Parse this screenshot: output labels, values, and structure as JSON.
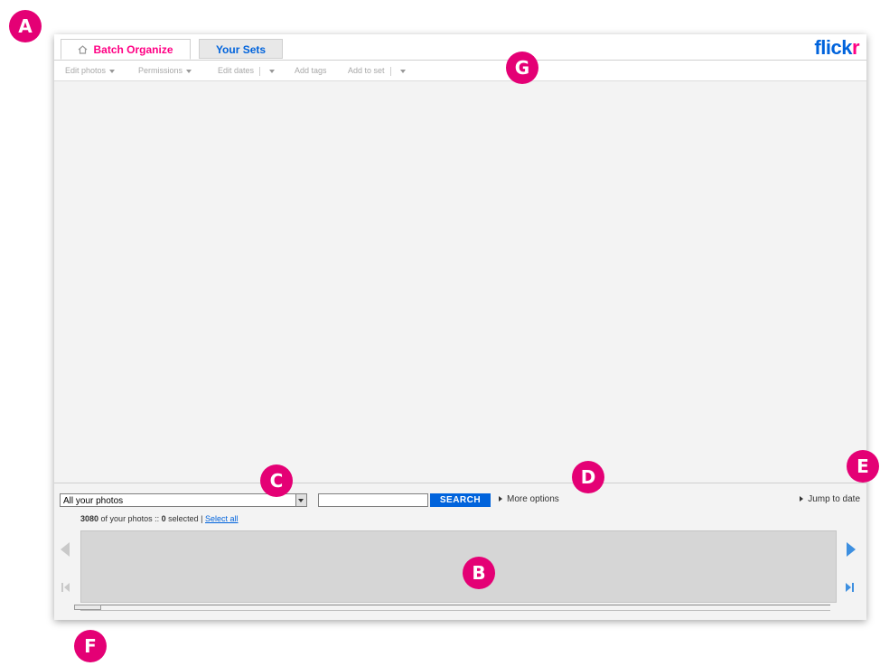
{
  "tabs": [
    {
      "label": "Batch Organize",
      "active": true
    },
    {
      "label": "Your Sets",
      "active": false
    }
  ],
  "logo": {
    "part1": "flick",
    "part2": "r"
  },
  "toolbar": {
    "edit_photos": "Edit photos",
    "permissions": "Permissions",
    "edit_dates": "Edit dates",
    "add_tags": "Add tags",
    "add_to_set": "Add to set"
  },
  "filter": {
    "selected": "All your photos"
  },
  "search": {
    "button_label": "SEARCH",
    "value": ""
  },
  "more_options": "More options",
  "jump_to_date": "Jump to date",
  "status": {
    "count": "3080",
    "text1": "of your photos ::",
    "selected": "0",
    "text2": "selected |",
    "select_all": "Select all"
  },
  "callouts": [
    "A",
    "B",
    "C",
    "D",
    "E",
    "F",
    "G"
  ],
  "colors": {
    "flickr_blue": "#0063dc",
    "flickr_pink": "#ff0084",
    "badge": "#e40075"
  },
  "icons": {
    "tab_home": "home-icon",
    "nav_left": "arrow-left-icon",
    "nav_right": "arrow-right-icon",
    "nav_first": "skip-first-icon",
    "nav_last": "skip-last-icon"
  }
}
